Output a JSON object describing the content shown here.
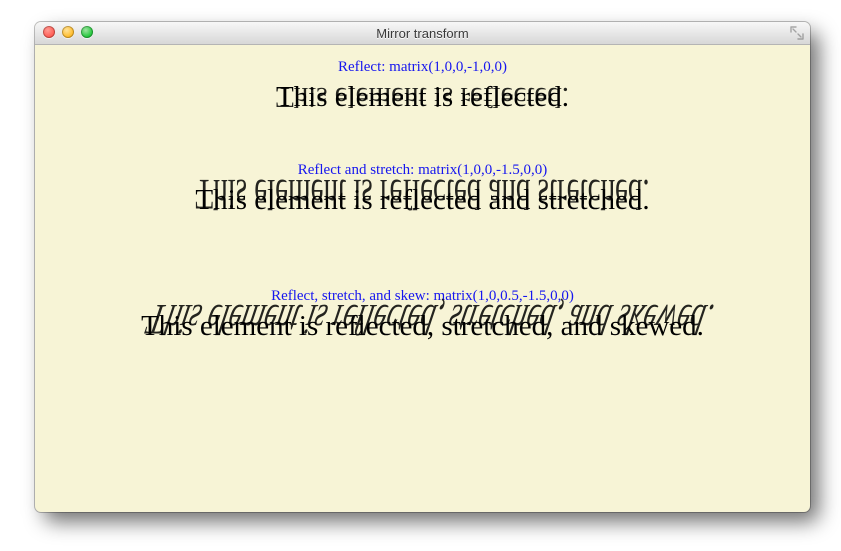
{
  "window": {
    "title": "Mirror transform"
  },
  "sections": [
    {
      "caption": "Reflect: matrix(1,0,0,-1,0,0)",
      "text": "This element is reflected."
    },
    {
      "caption": "Reflect and stretch: matrix(1,0,0,-1.5,0,0)",
      "text": "This element is reflected and stretched."
    },
    {
      "caption": "Reflect, stretch, and skew: matrix(1,0,0.5,-1.5,0,0)",
      "text": "This element is reflected, stretched, and skewed."
    }
  ]
}
